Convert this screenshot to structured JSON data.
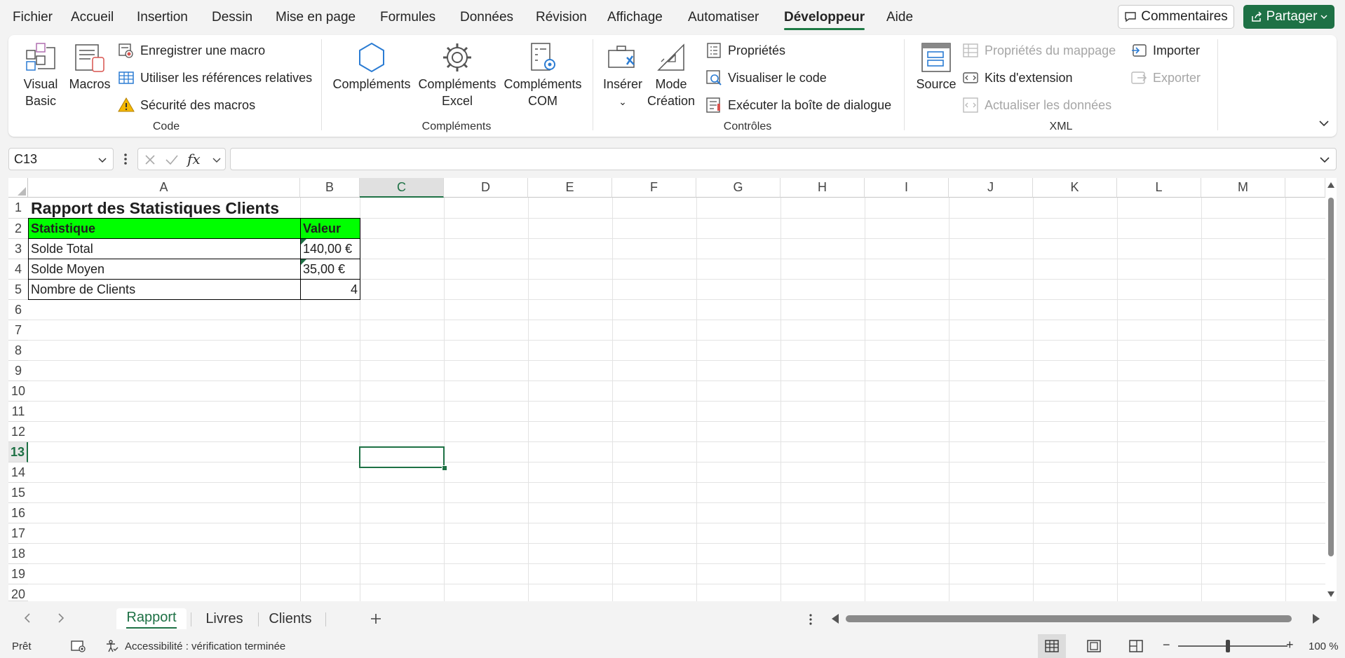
{
  "menu": {
    "items": [
      "Fichier",
      "Accueil",
      "Insertion",
      "Dessin",
      "Mise en page",
      "Formules",
      "Données",
      "Révision",
      "Affichage",
      "Automatiser",
      "Développeur",
      "Aide"
    ],
    "active": "Développeur",
    "comments_label": "Commentaires",
    "share_label": "Partager"
  },
  "ribbon": {
    "code": {
      "label": "Code",
      "visual_basic": "Visual Basic",
      "visual_basic_l1": "Visual",
      "visual_basic_l2": "Basic",
      "macros": "Macros",
      "record_macro": "Enregistrer une macro",
      "relative_refs": "Utiliser les références relatives",
      "macro_security": "Sécurité des macros"
    },
    "addins": {
      "label": "Compléments",
      "addins": "Compléments",
      "excel_addins_l1": "Compléments",
      "excel_addins_l2": "Excel",
      "com_addins_l1": "Compléments",
      "com_addins_l2": "COM"
    },
    "controls": {
      "label": "Contrôles",
      "insert": "Insérer",
      "design_mode_l1": "Mode",
      "design_mode_l2": "Création",
      "properties": "Propriétés",
      "view_code": "Visualiser le code",
      "run_dialog": "Exécuter la boîte de dialogue"
    },
    "xml": {
      "label": "XML",
      "source": "Source",
      "map_properties": "Propriétés du mappage",
      "expansion_packs": "Kits d'extension",
      "refresh_data": "Actualiser les données",
      "import": "Importer",
      "export": "Exporter"
    }
  },
  "formula_bar": {
    "name_box": "C13",
    "formula": ""
  },
  "grid": {
    "columns": [
      "A",
      "B",
      "C",
      "D",
      "E",
      "F",
      "G",
      "H",
      "I",
      "J",
      "K",
      "L",
      "M"
    ],
    "rows": [
      "1",
      "2",
      "3",
      "4",
      "5",
      "6",
      "7",
      "8",
      "9",
      "10",
      "11",
      "12",
      "13",
      "14",
      "15",
      "16",
      "17",
      "18",
      "19",
      "20"
    ],
    "selected_cell": "C13",
    "cells": {
      "A1": "Rapport des Statistiques Clients",
      "A2": "Statistique",
      "B2": "Valeur",
      "A3": "Solde Total",
      "B3": "140,00 €",
      "A4": "Solde Moyen",
      "B4": "35,00 €",
      "A5": "Nombre de Clients",
      "B5": "4"
    },
    "header_fill": "#00ff00"
  },
  "sheets": {
    "tabs": [
      "Rapport",
      "Livres",
      "Clients"
    ],
    "active": "Rapport"
  },
  "status": {
    "ready": "Prêt",
    "accessibility": "Accessibilité : vérification terminée",
    "zoom": "100 %"
  }
}
